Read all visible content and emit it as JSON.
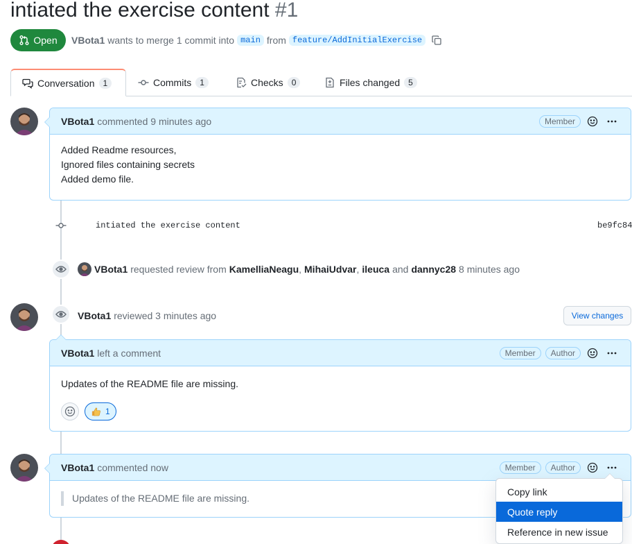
{
  "pr": {
    "title": "intiated the exercise content",
    "number": "#1",
    "state": "Open",
    "author": "VBota1",
    "merge_text": "wants to merge 1 commit into",
    "base_branch": "main",
    "from_text": "from",
    "head_branch": "feature/AddInitialExercise"
  },
  "tabs": [
    {
      "label": "Conversation",
      "count": "1"
    },
    {
      "label": "Commits",
      "count": "1"
    },
    {
      "label": "Checks",
      "count": "0"
    },
    {
      "label": "Files changed",
      "count": "5"
    }
  ],
  "comment1": {
    "author": "VBota1",
    "action": "commented 9 minutes ago",
    "role": "Member",
    "lines": [
      "Added Readme resources,",
      "Ignored files containing secrets",
      "Added demo file."
    ]
  },
  "commit": {
    "message": "intiated the exercise content",
    "sha": "be9fc84"
  },
  "review_request": {
    "author": "VBota1",
    "text": "requested review from",
    "reviewers": [
      "KamelliaNeagu",
      "MihaiUdvar",
      "ileuca"
    ],
    "and_text": "and",
    "last_reviewer": "dannyc28",
    "time": "8 minutes ago",
    "comma": ","
  },
  "review": {
    "author": "VBota1",
    "text": "reviewed 3 minutes ago",
    "view_changes": "View changes"
  },
  "comment2": {
    "author": "VBota1",
    "action": "left a comment",
    "role1": "Member",
    "role2": "Author",
    "body": "Updates of the README file are missing.",
    "reaction_count": "1"
  },
  "comment3": {
    "author": "VBota1",
    "action": "commented now",
    "role1": "Member",
    "role2": "Author",
    "quote": "Updates of the README file are missing."
  },
  "menu": {
    "items": [
      "Copy link",
      "Quote reply",
      "Reference in new issue"
    ],
    "selected_index": 1
  },
  "colors": {
    "open_green": "#1f883d",
    "accent_blue": "#0969da",
    "header_blue": "#ddf4ff",
    "tab_underline": "#fd8c73"
  }
}
